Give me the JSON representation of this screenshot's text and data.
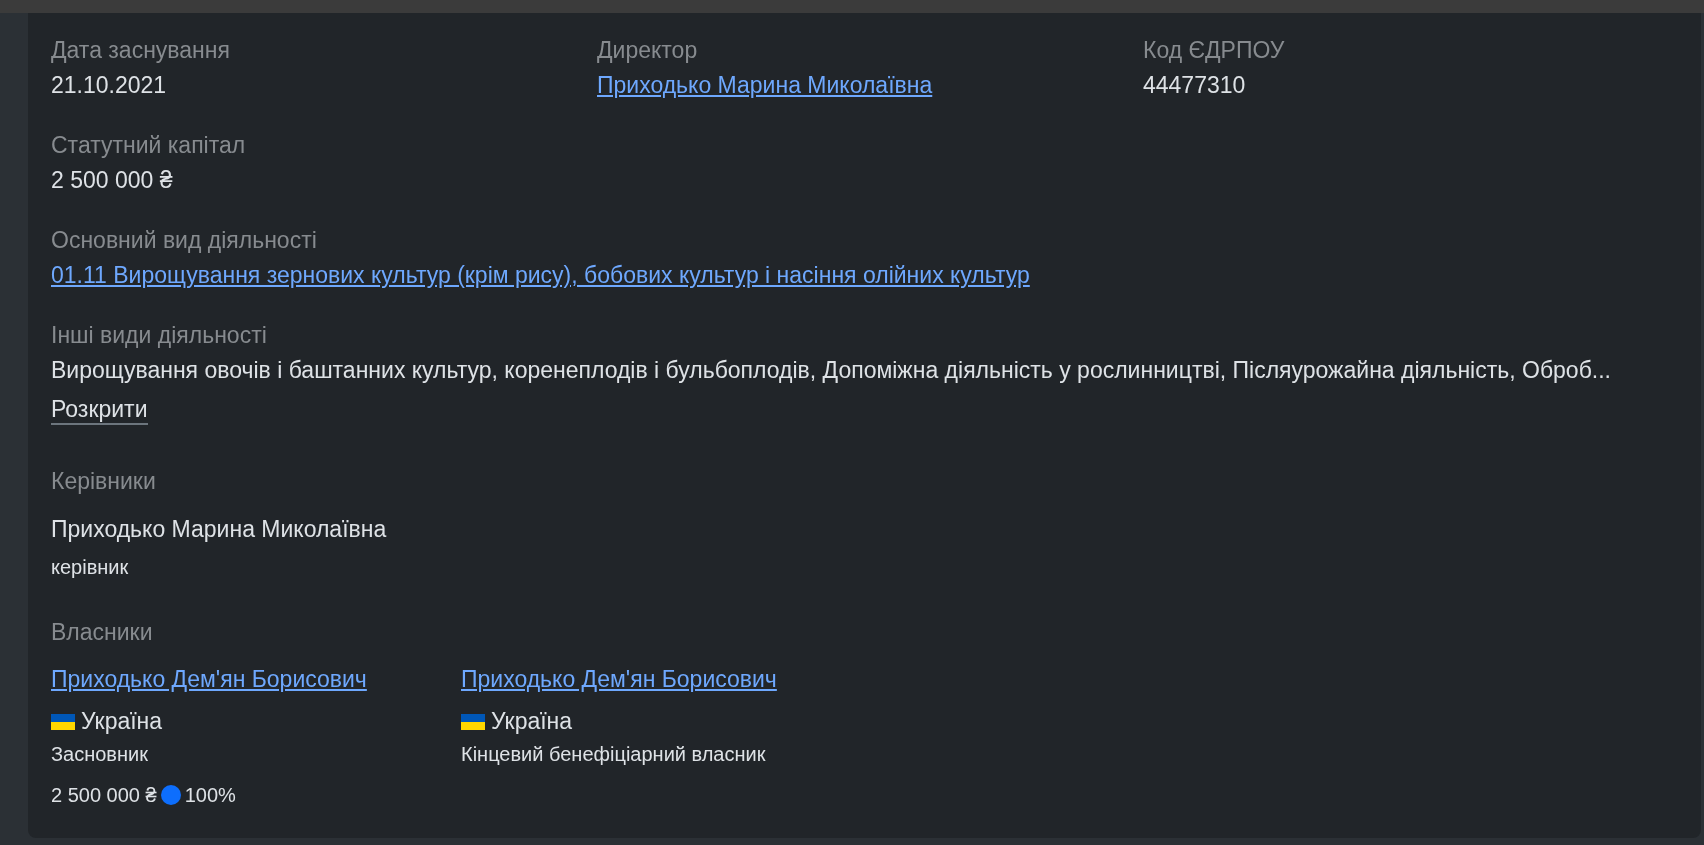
{
  "info_rows": [
    [
      {
        "kind": "text",
        "label": "Дата заснування",
        "value": "21.10.2021"
      },
      {
        "kind": "link",
        "label": "Директор",
        "value": "Приходько Марина Миколаївна"
      },
      {
        "kind": "text",
        "label": "Код ЄДРПОУ",
        "value": "44477310"
      }
    ],
    [
      {
        "kind": "text",
        "label": "Статутний капітал",
        "value": "2 500 000 ₴"
      }
    ],
    [
      {
        "kind": "link",
        "label": "Основний вид діяльності",
        "value": "01.11 Вирощування зернових культур (крім рису), бобових культур і насіння олійних культур"
      }
    ],
    [
      {
        "kind": "text",
        "label": "Інші види діяльності",
        "value": "Вирощування овочів і баштанних культур, коренеплодів і бульбоплодів, Допоміжна діяльність у рослинництві, Післяурожайна діяльність, Оброб...",
        "toggle": "Розкрити"
      }
    ]
  ],
  "managers": {
    "title": "Керівники",
    "items": [
      {
        "name": "Приходько Марина Миколаївна",
        "role": "керівник"
      }
    ]
  },
  "owners": {
    "title": "Власники",
    "items": [
      {
        "name": "Приходько Дем'ян Борисович",
        "country": "Україна",
        "role": "Засновник",
        "share_amount": "2 500 000 ₴",
        "share_percent": "100%"
      },
      {
        "name": "Приходько Дем'ян Борисович",
        "country": "Україна",
        "role": "Кінцевий бенефіціарний власник"
      }
    ]
  }
}
